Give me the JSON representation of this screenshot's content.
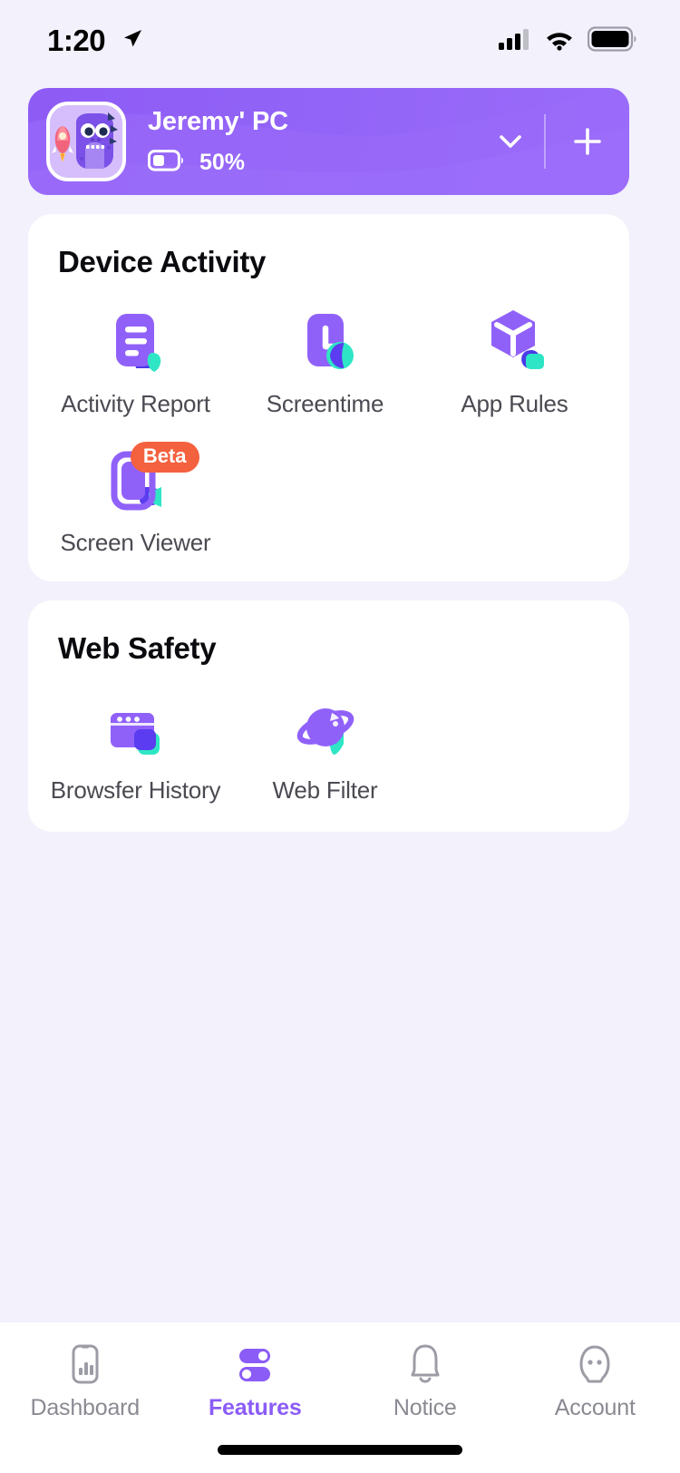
{
  "status_bar": {
    "time": "1:20",
    "location_icon": "location-arrow-icon",
    "signal_icon": "cellular-signal-icon",
    "wifi_icon": "wifi-icon",
    "battery_icon": "battery-full-icon"
  },
  "device_card": {
    "avatar_icon": "monster-avatar-icon",
    "name": "Jeremy' PC",
    "battery_icon": "battery-half-icon",
    "battery_text": "50%",
    "expand_icon": "chevron-down-icon",
    "add_icon": "plus-icon",
    "accent": "#8E5BF5"
  },
  "sections": [
    {
      "id": "device-activity",
      "title": "Device Activity",
      "tiles": [
        {
          "label": "Activity Report",
          "icon": "activity-report-icon",
          "badge": null
        },
        {
          "label": "Screentime",
          "icon": "screentime-clock-icon",
          "badge": null
        },
        {
          "label": "App Rules",
          "icon": "app-rules-cube-icon",
          "badge": null
        },
        {
          "label": "Screen Viewer",
          "icon": "screen-viewer-icon",
          "badge": "Beta"
        }
      ]
    },
    {
      "id": "web-safety",
      "title": "Web Safety",
      "tiles": [
        {
          "label": "Browsfer History",
          "icon": "browser-history-icon",
          "badge": null
        },
        {
          "label": "Web Filter",
          "icon": "web-filter-planet-icon",
          "badge": null
        }
      ]
    }
  ],
  "nav": {
    "active_index": 1,
    "active_color": "#8B5CF6",
    "inactive_color": "#8A8A93",
    "items": [
      {
        "label": "Dashboard",
        "icon": "dashboard-phone-chart-icon"
      },
      {
        "label": "Features",
        "icon": "features-toggles-icon"
      },
      {
        "label": "Notice",
        "icon": "notice-bell-icon"
      },
      {
        "label": "Account",
        "icon": "account-person-icon"
      }
    ]
  },
  "colors": {
    "background": "#F2F1FC",
    "card": "#FFFFFF",
    "purple": "#8B5CF6",
    "purple_light": "#9B6CFA",
    "teal": "#2EE6C5",
    "indigo": "#5B3CF0",
    "badge_orange": "#F4613F",
    "text_dark": "#0B0B0F",
    "text_gray": "#4A4A52"
  }
}
